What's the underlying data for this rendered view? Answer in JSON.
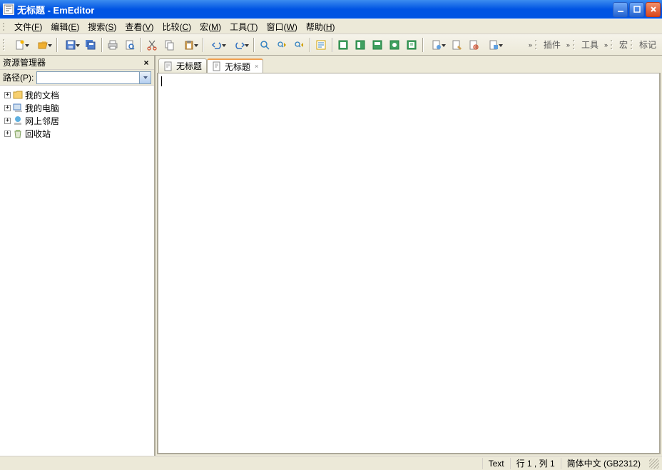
{
  "window": {
    "title": "无标题 - EmEditor"
  },
  "menu": [
    {
      "label": "文件",
      "acc": "F"
    },
    {
      "label": "编辑",
      "acc": "E"
    },
    {
      "label": "搜索",
      "acc": "S"
    },
    {
      "label": "查看",
      "acc": "V"
    },
    {
      "label": "比较",
      "acc": "C"
    },
    {
      "label": "宏",
      "acc": "M"
    },
    {
      "label": "工具",
      "acc": "T"
    },
    {
      "label": "窗口",
      "acc": "W"
    },
    {
      "label": "帮助",
      "acc": "H"
    }
  ],
  "toolbar_right": [
    {
      "label": "插件"
    },
    {
      "label": "工具"
    },
    {
      "label": "宏"
    },
    {
      "label": "标记"
    }
  ],
  "sidebar": {
    "title": "资源管理器",
    "path_label": "路径(P):",
    "path_value": "",
    "items": [
      {
        "label": "我的文档",
        "icon": "folder"
      },
      {
        "label": "我的电脑",
        "icon": "computer"
      },
      {
        "label": "网上邻居",
        "icon": "network"
      },
      {
        "label": "回收站",
        "icon": "recycle"
      }
    ]
  },
  "tabs": [
    {
      "label": "无标题",
      "active": false
    },
    {
      "label": "无标题",
      "active": true
    }
  ],
  "status": {
    "text_label": "Text",
    "position": "行 1 , 列 1",
    "encoding": "简体中文 (GB2312)"
  }
}
